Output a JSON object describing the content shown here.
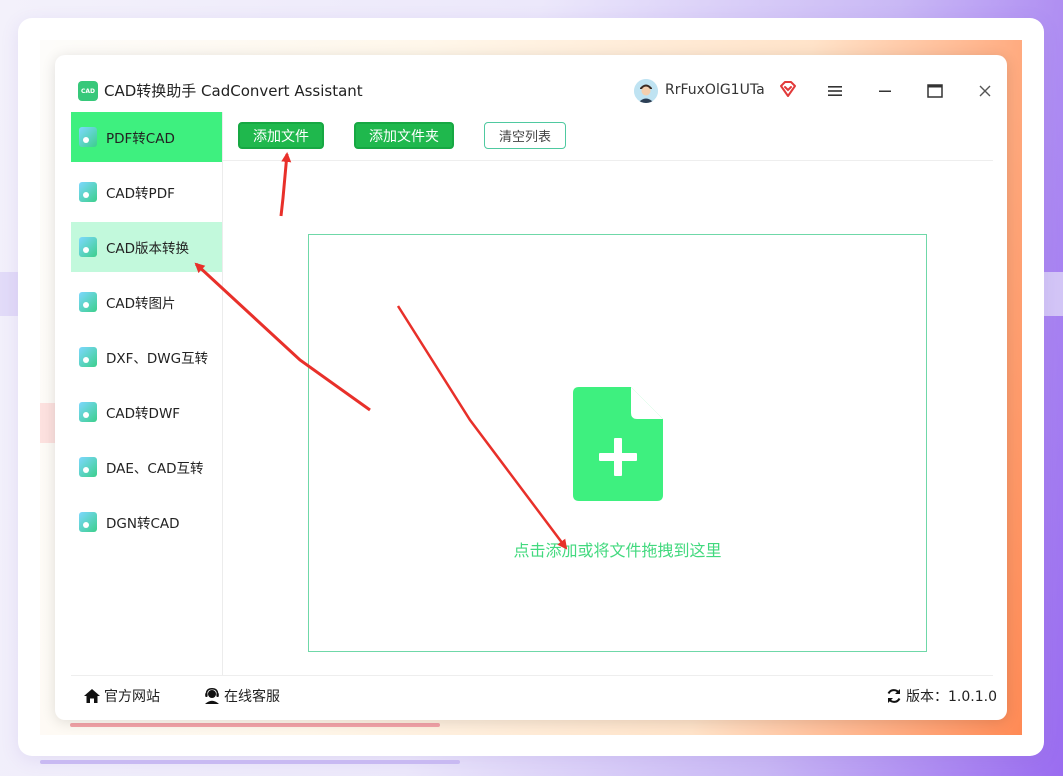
{
  "app": {
    "logo_text": "CAD",
    "title": "CAD转换助手 CadConvert Assistant",
    "username": "RrFuxOlG1UTa"
  },
  "sidebar": {
    "items": [
      {
        "label": "PDF转CAD"
      },
      {
        "label": "CAD转PDF"
      },
      {
        "label": "CAD版本转换"
      },
      {
        "label": "CAD转图片"
      },
      {
        "label": "DXF、DWG互转"
      },
      {
        "label": "CAD转DWF"
      },
      {
        "label": "DAE、CAD互转"
      },
      {
        "label": "DGN转CAD"
      }
    ]
  },
  "toolbar": {
    "add_file": "添加文件",
    "add_folder": "添加文件夹",
    "clear_list": "清空列表"
  },
  "dropzone": {
    "hint": "点击添加或将文件拖拽到这里"
  },
  "footer": {
    "website": "官方网站",
    "support": "在线客服",
    "version": "版本：1.0.1.0"
  },
  "colors": {
    "accent_green": "#3ef07f",
    "button_green": "#1fb84d",
    "hover_green": "#c2f9dc",
    "annotation_red": "#e8302a"
  }
}
